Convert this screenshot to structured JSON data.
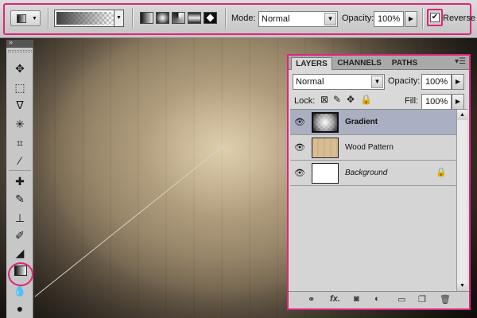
{
  "options_bar": {
    "mode_label": "Mode:",
    "mode_value": "Normal",
    "opacity_label": "Opacity:",
    "opacity_value": "100%",
    "reverse_label": "Reverse",
    "reverse_checked": true,
    "gradient_types": [
      "linear",
      "radial",
      "angle",
      "reflected",
      "diamond"
    ]
  },
  "toolbar": {
    "tools": [
      "move",
      "rectangular-marquee",
      "lasso",
      "magic-wand",
      "crop",
      "eyedropper",
      "healing-brush",
      "brush",
      "clone-stamp",
      "history-brush",
      "eraser",
      "gradient",
      "blur",
      "dodge"
    ],
    "selected_tool": "gradient"
  },
  "layers_panel": {
    "tabs": [
      "LAYERS",
      "CHANNELS",
      "PATHS"
    ],
    "active_tab": "LAYERS",
    "blend_mode": "Normal",
    "opacity_label": "Opacity:",
    "opacity_value": "100%",
    "lock_label": "Lock:",
    "fill_label": "Fill:",
    "fill_value": "100%",
    "layers": [
      {
        "name": "Gradient",
        "selected": true,
        "visible": true
      },
      {
        "name": "Wood Pattern",
        "selected": false,
        "visible": true
      },
      {
        "name": "Background",
        "selected": false,
        "visible": true,
        "locked": true
      }
    ]
  },
  "colors": {
    "highlight": "#e0247a",
    "selected_layer": "#aab0c1"
  }
}
